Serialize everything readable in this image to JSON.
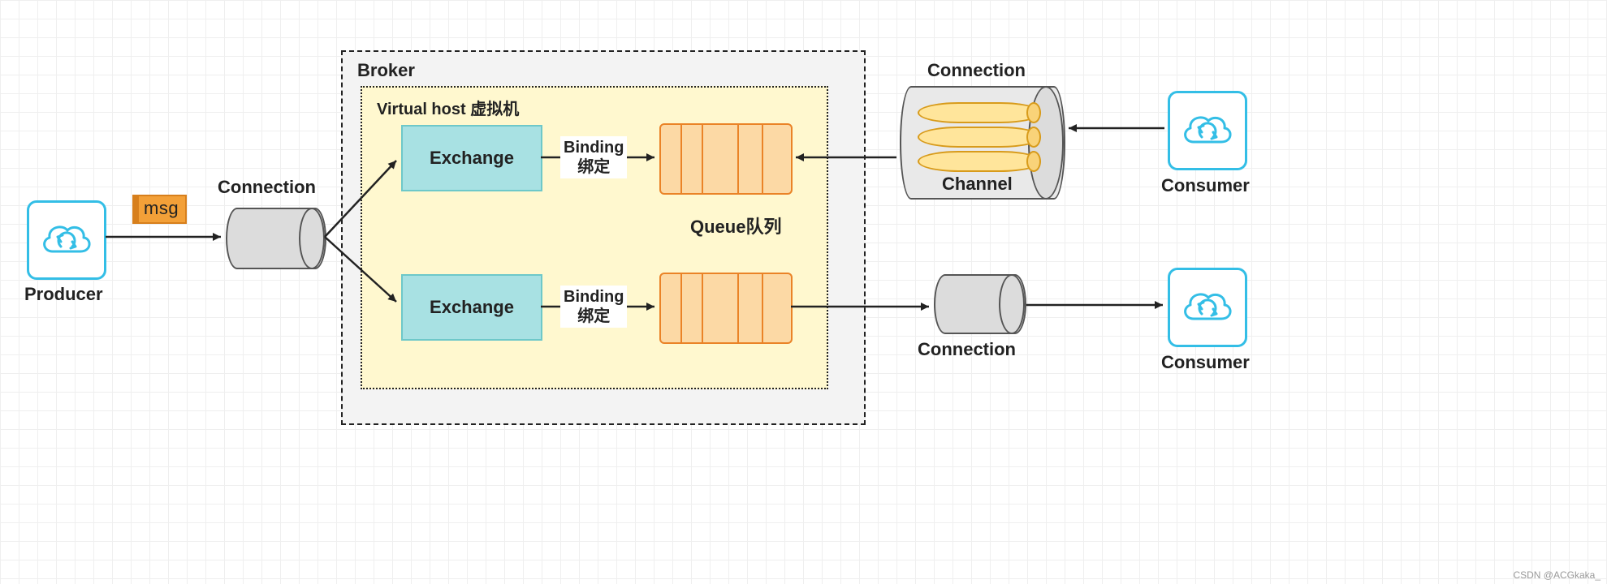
{
  "producer": {
    "label": "Producer"
  },
  "msg": {
    "label": "msg"
  },
  "connection_producer": {
    "label": "Connection"
  },
  "broker": {
    "title": "Broker"
  },
  "vhost": {
    "title": "Virtual host 虚拟机"
  },
  "exchange1": {
    "label": "Exchange"
  },
  "exchange2": {
    "label": "Exchange"
  },
  "binding1": {
    "line1": "Binding",
    "line2": "绑定"
  },
  "binding2": {
    "line1": "Binding",
    "line2": "绑定"
  },
  "queue_caption": "Queue队列",
  "connection_top": {
    "label": "Connection"
  },
  "channel": {
    "label": "Channel"
  },
  "connection_bottom": {
    "label": "Connection"
  },
  "consumer1": {
    "label": "Consumer"
  },
  "consumer2": {
    "label": "Consumer"
  },
  "watermark": "CSDN @ACGkaka_"
}
